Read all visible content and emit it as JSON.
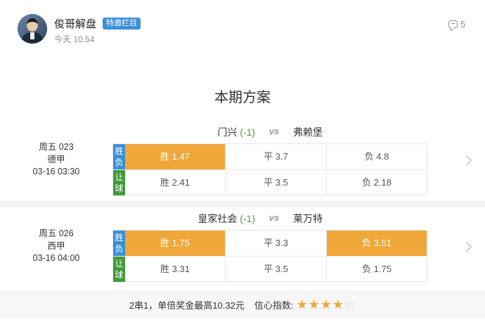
{
  "header": {
    "author_name": "俊哥解盘",
    "badge": "特邀栏目",
    "post_time": "今天 10:54",
    "comment_count": "5"
  },
  "plan_title": "本期方案",
  "matches": [
    {
      "home": "门兴",
      "handicap": "(-1)",
      "vs": "vs",
      "away": "弗赖堡",
      "info": {
        "number": "周五 023",
        "league": "德甲",
        "datetime": "03-16 03:30"
      },
      "rows": [
        {
          "tag": "胜负",
          "tag_color": "#3b8fd5",
          "cells": [
            {
              "text": "胜 1.47",
              "selected": true
            },
            {
              "text": "平 3.7",
              "selected": false
            },
            {
              "text": "负 4.8",
              "selected": false
            }
          ]
        },
        {
          "tag": "让球",
          "tag_color": "#3f9b3a",
          "cells": [
            {
              "text": "胜 2.41",
              "selected": false
            },
            {
              "text": "平 3.5",
              "selected": false
            },
            {
              "text": "负 2.18",
              "selected": false
            }
          ]
        }
      ]
    },
    {
      "home": "皇家社会",
      "handicap": "(-1)",
      "vs": "vs",
      "away": "莱万特",
      "info": {
        "number": "周五 026",
        "league": "西甲",
        "datetime": "03-16 04:00"
      },
      "rows": [
        {
          "tag": "胜负",
          "tag_color": "#3b8fd5",
          "cells": [
            {
              "text": "胜 1.75",
              "selected": true
            },
            {
              "text": "平 3.3",
              "selected": false
            },
            {
              "text": "负 3.51",
              "selected": true
            }
          ]
        },
        {
          "tag": "让球",
          "tag_color": "#3f9b3a",
          "cells": [
            {
              "text": "胜 3.31",
              "selected": false
            },
            {
              "text": "平 3.5",
              "selected": false
            },
            {
              "text": "负 1.75",
              "selected": false
            }
          ]
        }
      ]
    }
  ],
  "footer": {
    "summary": "2串1，单倍奖金最高10.32元",
    "confidence_label": "信心指数:",
    "confidence_rating": 4,
    "confidence_max": 5
  },
  "colors": {
    "selected_odds": "#f0a73a",
    "tag_result": "#3b8fd5",
    "tag_handicap": "#3f9b3a",
    "handicap_text": "#4a9a3c"
  },
  "icons": [
    "comment-icon",
    "chevron-right-icon",
    "star-icon"
  ]
}
